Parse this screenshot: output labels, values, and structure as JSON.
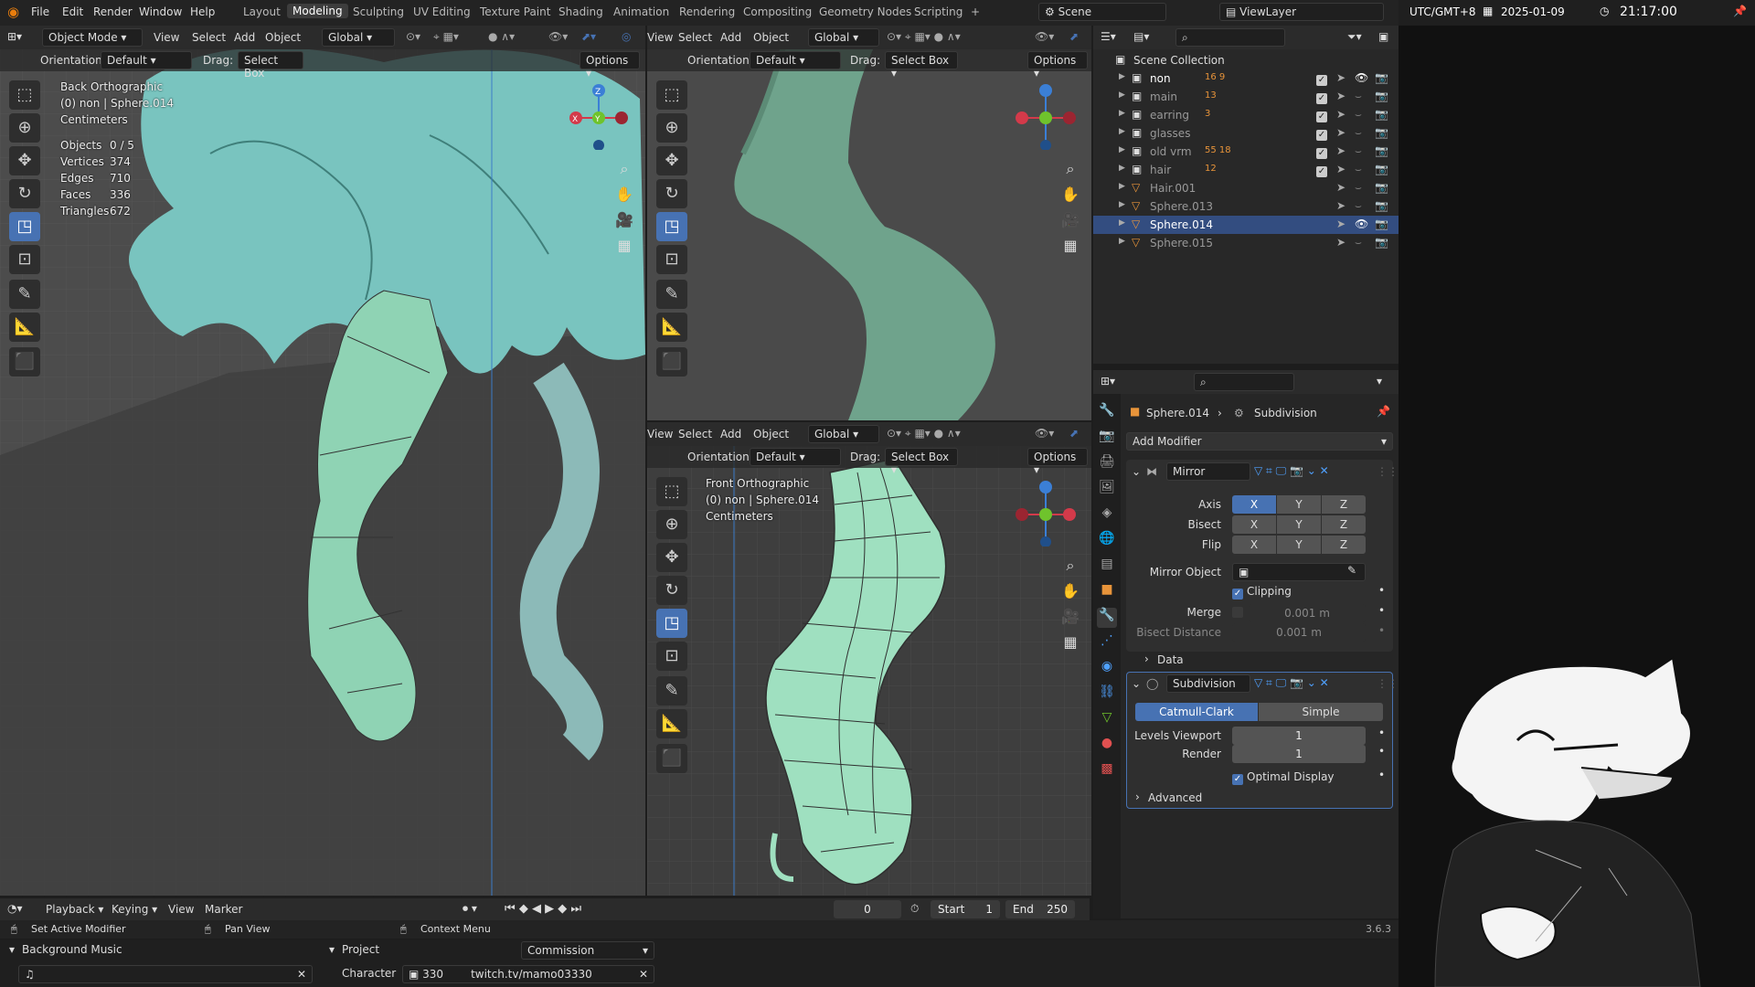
{
  "topbar": {
    "menus": [
      "File",
      "Edit",
      "Render",
      "Window",
      "Help"
    ],
    "workspaces": [
      "Layout",
      "Modeling",
      "Sculpting",
      "UV Editing",
      "Texture Paint",
      "Shading",
      "Animation",
      "Rendering",
      "Compositing",
      "Geometry Nodes",
      "Scripting"
    ],
    "active_workspace": "Modeling",
    "plus": "+",
    "scene": "Scene",
    "view_layer": "ViewLayer"
  },
  "clock": {
    "tz": "UTC/GMT+8",
    "date": "2025-01-09",
    "time": "21:17:00"
  },
  "viewport_left": {
    "mode": "Object Mode",
    "menus": [
      "View",
      "Select",
      "Add",
      "Object"
    ],
    "transform": "Global",
    "orientation_label": "Orientation:",
    "orientation_value": "Default",
    "drag_label": "Drag:",
    "drag_value": "Select Box",
    "options": "Options",
    "overlay_title": "Back Orthographic",
    "overlay_object": "(0) non | Sphere.014",
    "overlay_units": "Centimeters",
    "stats": [
      {
        "label": "Objects",
        "value": "0 / 5"
      },
      {
        "label": "Vertices",
        "value": "374"
      },
      {
        "label": "Edges",
        "value": "710"
      },
      {
        "label": "Faces",
        "value": "336"
      },
      {
        "label": "Triangles",
        "value": "672"
      }
    ]
  },
  "viewport_top_right": {
    "menus": [
      "View",
      "Select",
      "Add",
      "Object"
    ],
    "transform": "Global",
    "orientation_label": "Orientation:",
    "orientation_value": "Default",
    "drag_label": "Drag:",
    "drag_value": "Select Box",
    "options": "Options"
  },
  "viewport_bottom_right": {
    "menus": [
      "View",
      "Select",
      "Add",
      "Object"
    ],
    "transform": "Global",
    "orientation_label": "Orientation:",
    "orientation_value": "Default",
    "drag_label": "Drag:",
    "drag_value": "Select Box",
    "options": "Options",
    "overlay_title": "Front Orthographic",
    "overlay_object": "(0) non | Sphere.014",
    "overlay_units": "Centimeters"
  },
  "gizmo": {
    "x": "X",
    "y": "Y",
    "z": "Z"
  },
  "outliner": {
    "collection": "Scene Collection",
    "items": [
      {
        "name": "non",
        "badges": "16 9",
        "visible": true
      },
      {
        "name": "main",
        "badges": "13",
        "visible": false
      },
      {
        "name": "earring",
        "badges": "3",
        "visible": false
      },
      {
        "name": "glasses",
        "badges": "",
        "visible": false
      },
      {
        "name": "old vrm",
        "badges": "55 18",
        "visible": false
      },
      {
        "name": "hair",
        "badges": "12",
        "visible": false
      },
      {
        "name": "Hair.001",
        "badges": "",
        "visible": false
      },
      {
        "name": "Sphere.013",
        "badges": "",
        "visible": false
      },
      {
        "name": "Sphere.014",
        "badges": "",
        "visible": true
      },
      {
        "name": "Sphere.015",
        "badges": "",
        "visible": false
      }
    ]
  },
  "properties": {
    "object": "Sphere.014",
    "modifier_breadcrumb": "Subdivision",
    "add_modifier": "Add Modifier",
    "mirror": {
      "name": "Mirror",
      "axis_label": "Axis",
      "bisect_label": "Bisect",
      "flip_label": "Flip",
      "x": "X",
      "y": "Y",
      "z": "Z",
      "mirror_object_label": "Mirror Object",
      "clipping_label": "Clipping",
      "merge_label": "Merge",
      "merge_value": "0.001 m",
      "bisect_distance_label": "Bisect Distance",
      "bisect_distance_value": "0.001 m",
      "data_label": "Data"
    },
    "subdivision": {
      "name": "Subdivision",
      "catmull": "Catmull-Clark",
      "simple": "Simple",
      "levels_viewport_label": "Levels Viewport",
      "levels_viewport_value": "1",
      "render_label": "Render",
      "render_value": "1",
      "optimal_label": "Optimal Display",
      "advanced_label": "Advanced"
    }
  },
  "timeline": {
    "menus": [
      "Playback",
      "Keying",
      "View",
      "Marker"
    ],
    "current_frame": "0",
    "start_label": "Start",
    "start_value": "1",
    "end_label": "End",
    "end_value": "250"
  },
  "status": {
    "left": "Set Active Modifier",
    "middle": "Pan View",
    "right": "Context Menu",
    "version": "3.6.3"
  },
  "bottom": {
    "bg_music": "Background Music",
    "project_label": "Project",
    "project_value": "Commission",
    "character_label": "Character",
    "character_value": "330",
    "url": "twitch.tv/mamo03330"
  },
  "colors": {
    "accent": "#4772b3",
    "hair": "#8fd3b4",
    "hair_dark": "#5aa58a",
    "grid_bg": "#4a4a4a"
  }
}
